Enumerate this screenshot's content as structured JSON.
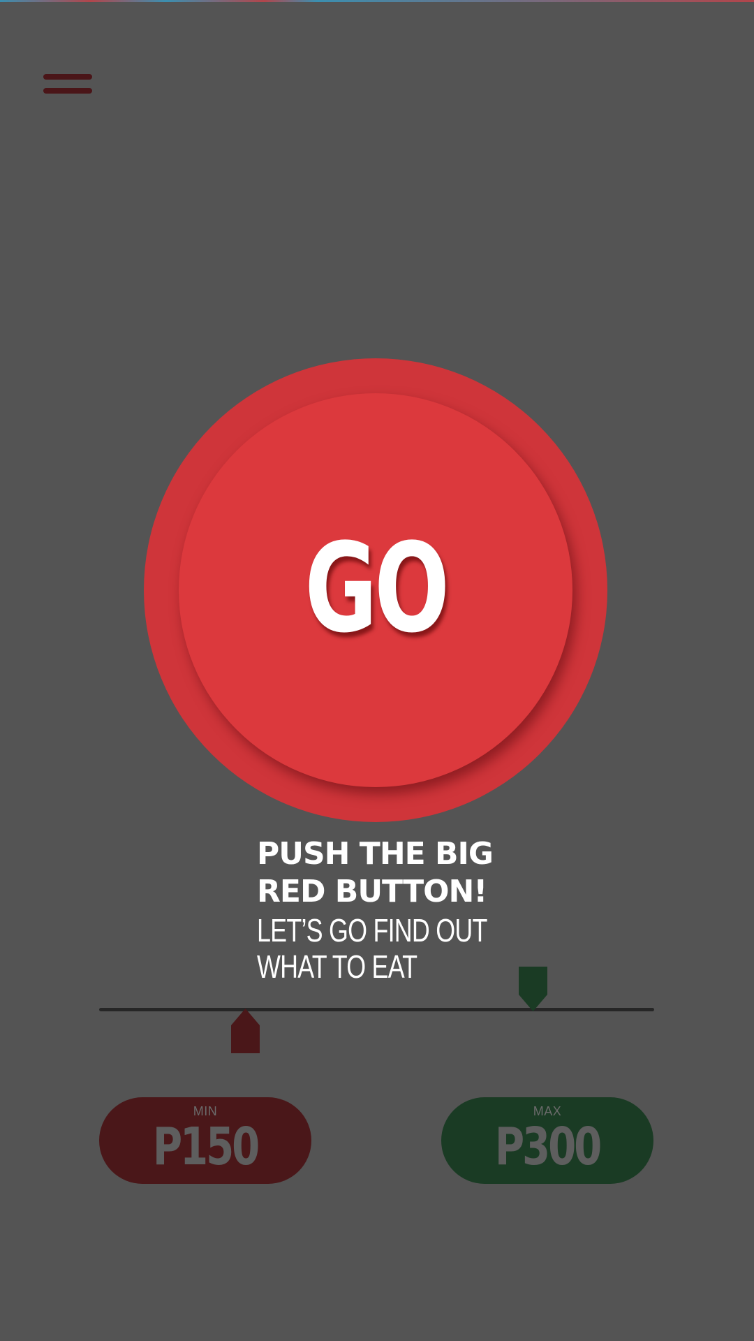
{
  "header": {
    "menu_icon": "hamburger-icon"
  },
  "go_button": {
    "label": "GO",
    "color": "#dc393d"
  },
  "prompt": {
    "headline_line1": "PUSH THE BIG",
    "headline_line2": "RED BUTTON!",
    "subline_line1": "LET’S GO FIND OUT",
    "subline_line2": "WHAT TO EAT"
  },
  "budget": {
    "min": {
      "label": "MIN",
      "value": "P150",
      "color": "#4a1719"
    },
    "max": {
      "label": "MAX",
      "value": "P300",
      "color": "#1a3b24"
    },
    "min_handle_position": 0.27,
    "max_handle_position": 0.78
  },
  "colors": {
    "background": "#545454",
    "accent_red": "#dc393d",
    "accent_green": "#1a3b24"
  }
}
